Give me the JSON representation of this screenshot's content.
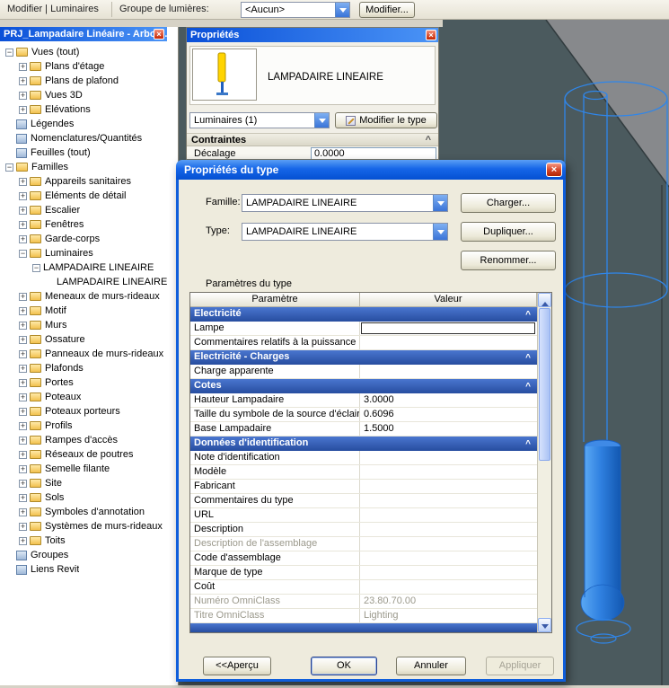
{
  "toolbar": {
    "mode_label": "Modifier | Luminaires",
    "group_label": "Groupe de lumières:",
    "group_value": "<Aucun>",
    "modify_button": "Modifier..."
  },
  "project_browser": {
    "title": "PRJ_Lampadaire Linéaire - Arbor...",
    "tree": [
      {
        "label": "Vues (tout)",
        "level": 1,
        "exp": "-",
        "icon": "folder"
      },
      {
        "label": "Plans d'étage",
        "level": 2,
        "exp": "+",
        "icon": "folder"
      },
      {
        "label": "Plans de plafond",
        "level": 2,
        "exp": "+",
        "icon": "folder"
      },
      {
        "label": "Vues 3D",
        "level": 2,
        "exp": "+",
        "icon": "folder"
      },
      {
        "label": "Elévations",
        "level": 2,
        "exp": "+",
        "icon": "folder"
      },
      {
        "label": "Légendes",
        "level": 1,
        "exp": "",
        "icon": "box"
      },
      {
        "label": "Nomenclatures/Quantités",
        "level": 1,
        "exp": "",
        "icon": "box"
      },
      {
        "label": "Feuilles (tout)",
        "level": 1,
        "exp": "",
        "icon": "box"
      },
      {
        "label": "Familles",
        "level": 1,
        "exp": "-",
        "icon": "folder"
      },
      {
        "label": "Appareils sanitaires",
        "level": 2,
        "exp": "+",
        "icon": "folder"
      },
      {
        "label": "Eléments de détail",
        "level": 2,
        "exp": "+",
        "icon": "folder"
      },
      {
        "label": "Escalier",
        "level": 2,
        "exp": "+",
        "icon": "folder"
      },
      {
        "label": "Fenêtres",
        "level": 2,
        "exp": "+",
        "icon": "folder"
      },
      {
        "label": "Garde-corps",
        "level": 2,
        "exp": "+",
        "icon": "folder"
      },
      {
        "label": "Luminaires",
        "level": 2,
        "exp": "-",
        "icon": "folder"
      },
      {
        "label": "LAMPADAIRE LINEAIRE",
        "level": 3,
        "exp": "-",
        "icon": ""
      },
      {
        "label": "LAMPADAIRE LINEAIRE",
        "level": 4,
        "exp": "",
        "icon": ""
      },
      {
        "label": "Meneaux de murs-rideaux",
        "level": 2,
        "exp": "+",
        "icon": "folder"
      },
      {
        "label": "Motif",
        "level": 2,
        "exp": "+",
        "icon": "folder"
      },
      {
        "label": "Murs",
        "level": 2,
        "exp": "+",
        "icon": "folder"
      },
      {
        "label": "Ossature",
        "level": 2,
        "exp": "+",
        "icon": "folder"
      },
      {
        "label": "Panneaux de murs-rideaux",
        "level": 2,
        "exp": "+",
        "icon": "folder"
      },
      {
        "label": "Plafonds",
        "level": 2,
        "exp": "+",
        "icon": "folder"
      },
      {
        "label": "Portes",
        "level": 2,
        "exp": "+",
        "icon": "folder"
      },
      {
        "label": "Poteaux",
        "level": 2,
        "exp": "+",
        "icon": "folder"
      },
      {
        "label": "Poteaux porteurs",
        "level": 2,
        "exp": "+",
        "icon": "folder"
      },
      {
        "label": "Profils",
        "level": 2,
        "exp": "+",
        "icon": "folder"
      },
      {
        "label": "Rampes d'accès",
        "level": 2,
        "exp": "+",
        "icon": "folder"
      },
      {
        "label": "Réseaux de poutres",
        "level": 2,
        "exp": "+",
        "icon": "folder"
      },
      {
        "label": "Semelle filante",
        "level": 2,
        "exp": "+",
        "icon": "folder"
      },
      {
        "label": "Site",
        "level": 2,
        "exp": "+",
        "icon": "folder"
      },
      {
        "label": "Sols",
        "level": 2,
        "exp": "+",
        "icon": "folder"
      },
      {
        "label": "Symboles d'annotation",
        "level": 2,
        "exp": "+",
        "icon": "folder"
      },
      {
        "label": "Systèmes de murs-rideaux",
        "level": 2,
        "exp": "+",
        "icon": "folder"
      },
      {
        "label": "Toits",
        "level": 2,
        "exp": "+",
        "icon": "folder"
      },
      {
        "label": "Groupes",
        "level": 1,
        "exp": "",
        "icon": "box"
      },
      {
        "label": "Liens Revit",
        "level": 1,
        "exp": "",
        "icon": "box"
      }
    ]
  },
  "properties_palette": {
    "title": "Propriétés",
    "preview_label": "LAMPADAIRE LINEAIRE",
    "selector_value": "Luminaires (1)",
    "edit_type_button": "Modifier le type",
    "section": "Contraintes",
    "row": {
      "param": "Décalage",
      "value": "0.0000"
    }
  },
  "type_dialog": {
    "title": "Propriétés du type",
    "family_label": "Famille:",
    "family_value": "LAMPADAIRE LINEAIRE",
    "load_button": "Charger...",
    "type_label": "Type:",
    "type_value": "LAMPADAIRE LINEAIRE",
    "duplicate_button": "Dupliquer...",
    "rename_button": "Renommer...",
    "params_label": "Paramètres du type",
    "table": {
      "col_param": "Paramètre",
      "col_value": "Valeur",
      "rows": [
        {
          "type": "section",
          "label": "Electricité"
        },
        {
          "type": "row",
          "param": "Lampe",
          "value": "",
          "input": true
        },
        {
          "type": "row",
          "param": "Commentaires relatifs à la puissance",
          "value": ""
        },
        {
          "type": "section",
          "label": "Electricité - Charges"
        },
        {
          "type": "row",
          "param": "Charge apparente",
          "value": ""
        },
        {
          "type": "section",
          "label": "Cotes"
        },
        {
          "type": "row",
          "param": "Hauteur Lampadaire",
          "value": "3.0000"
        },
        {
          "type": "row",
          "param": "Taille du symbole de la source d'éclairage",
          "value": "0.6096"
        },
        {
          "type": "row",
          "param": "Base Lampadaire",
          "value": "1.5000"
        },
        {
          "type": "section",
          "label": "Données d'identification"
        },
        {
          "type": "row",
          "param": "Note d'identification",
          "value": ""
        },
        {
          "type": "row",
          "param": "Modèle",
          "value": ""
        },
        {
          "type": "row",
          "param": "Fabricant",
          "value": ""
        },
        {
          "type": "row",
          "param": "Commentaires du type",
          "value": ""
        },
        {
          "type": "row",
          "param": "URL",
          "value": ""
        },
        {
          "type": "row",
          "param": "Description",
          "value": ""
        },
        {
          "type": "row",
          "param": "Description de l'assemblage",
          "value": "",
          "disabled": true
        },
        {
          "type": "row",
          "param": "Code d'assemblage",
          "value": ""
        },
        {
          "type": "row",
          "param": "Marque de type",
          "value": ""
        },
        {
          "type": "row",
          "param": "Coût",
          "value": ""
        },
        {
          "type": "row",
          "param": "Numéro OmniClass",
          "value": "23.80.70.00",
          "disabled": true
        },
        {
          "type": "row",
          "param": "Titre OmniClass",
          "value": "Lighting",
          "disabled": true
        },
        {
          "type": "section",
          "label": "",
          "partial": true
        }
      ]
    },
    "buttons": {
      "preview": "<<Aperçu",
      "ok": "OK",
      "cancel": "Annuler",
      "apply": "Appliquer"
    }
  }
}
